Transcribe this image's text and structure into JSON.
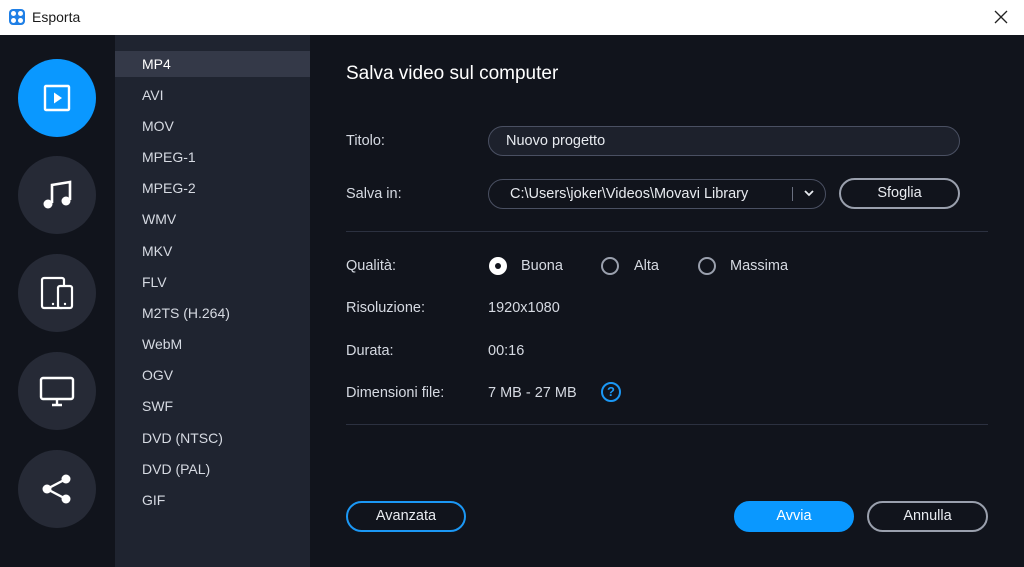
{
  "window": {
    "title": "Esporta"
  },
  "formats": [
    "MP4",
    "AVI",
    "MOV",
    "MPEG-1",
    "MPEG-2",
    "WMV",
    "MKV",
    "FLV",
    "M2TS (H.264)",
    "WebM",
    "OGV",
    "SWF",
    "DVD (NTSC)",
    "DVD (PAL)",
    "GIF"
  ],
  "selected_format": "MP4",
  "categories": [
    {
      "icon": "play-video-icon",
      "active": true
    },
    {
      "icon": "music-note-icon",
      "active": false
    },
    {
      "icon": "devices-icon",
      "active": false
    },
    {
      "icon": "monitor-icon",
      "active": false
    },
    {
      "icon": "share-icon",
      "active": false
    }
  ],
  "panel": {
    "heading": "Salva video sul computer",
    "title_label": "Titolo:",
    "title_value": "Nuovo progetto",
    "save_in_label": "Salva in:",
    "save_in_value": "C:\\Users\\joker\\Videos\\Movavi Library",
    "browse_button": "Sfoglia",
    "quality_label": "Qualità:",
    "quality_options": [
      "Buona",
      "Alta",
      "Massima"
    ],
    "quality_selected": "Buona",
    "resolution_label": "Risoluzione:",
    "resolution_value": "1920x1080",
    "duration_label": "Durata:",
    "duration_value": "00:16",
    "filesize_label": "Dimensioni file:",
    "filesize_value": "7 MB - 27 MB",
    "help_symbol": "?",
    "advanced_button": "Avanzata",
    "start_button": "Avvia",
    "cancel_button": "Annulla"
  },
  "colors": {
    "accent": "#0a98ff",
    "sidebar": "#1f2430",
    "background": "#11141c"
  }
}
